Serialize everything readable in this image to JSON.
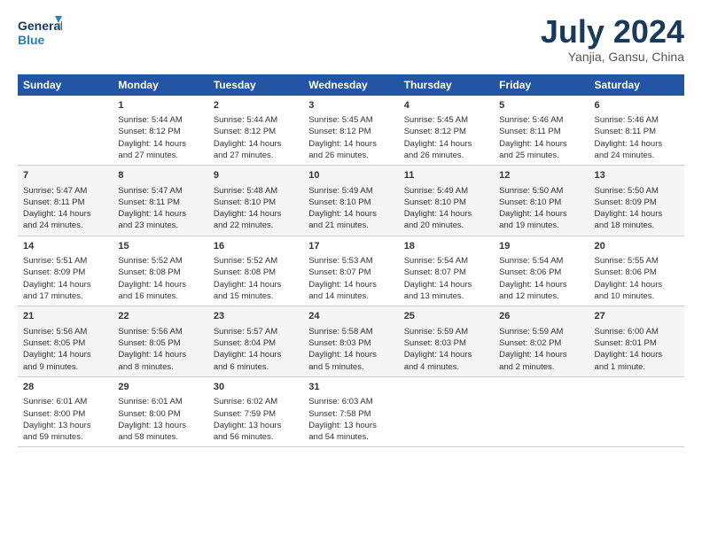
{
  "logo": {
    "text_general": "General",
    "text_blue": "Blue"
  },
  "title": "July 2024",
  "location": "Yanjia, Gansu, China",
  "header": {
    "days": [
      "Sunday",
      "Monday",
      "Tuesday",
      "Wednesday",
      "Thursday",
      "Friday",
      "Saturday"
    ]
  },
  "weeks": [
    [
      {
        "num": "",
        "info": ""
      },
      {
        "num": "1",
        "info": "Sunrise: 5:44 AM\nSunset: 8:12 PM\nDaylight: 14 hours\nand 27 minutes."
      },
      {
        "num": "2",
        "info": "Sunrise: 5:44 AM\nSunset: 8:12 PM\nDaylight: 14 hours\nand 27 minutes."
      },
      {
        "num": "3",
        "info": "Sunrise: 5:45 AM\nSunset: 8:12 PM\nDaylight: 14 hours\nand 26 minutes."
      },
      {
        "num": "4",
        "info": "Sunrise: 5:45 AM\nSunset: 8:12 PM\nDaylight: 14 hours\nand 26 minutes."
      },
      {
        "num": "5",
        "info": "Sunrise: 5:46 AM\nSunset: 8:11 PM\nDaylight: 14 hours\nand 25 minutes."
      },
      {
        "num": "6",
        "info": "Sunrise: 5:46 AM\nSunset: 8:11 PM\nDaylight: 14 hours\nand 24 minutes."
      }
    ],
    [
      {
        "num": "7",
        "info": "Sunrise: 5:47 AM\nSunset: 8:11 PM\nDaylight: 14 hours\nand 24 minutes."
      },
      {
        "num": "8",
        "info": "Sunrise: 5:47 AM\nSunset: 8:11 PM\nDaylight: 14 hours\nand 23 minutes."
      },
      {
        "num": "9",
        "info": "Sunrise: 5:48 AM\nSunset: 8:10 PM\nDaylight: 14 hours\nand 22 minutes."
      },
      {
        "num": "10",
        "info": "Sunrise: 5:49 AM\nSunset: 8:10 PM\nDaylight: 14 hours\nand 21 minutes."
      },
      {
        "num": "11",
        "info": "Sunrise: 5:49 AM\nSunset: 8:10 PM\nDaylight: 14 hours\nand 20 minutes."
      },
      {
        "num": "12",
        "info": "Sunrise: 5:50 AM\nSunset: 8:10 PM\nDaylight: 14 hours\nand 19 minutes."
      },
      {
        "num": "13",
        "info": "Sunrise: 5:50 AM\nSunset: 8:09 PM\nDaylight: 14 hours\nand 18 minutes."
      }
    ],
    [
      {
        "num": "14",
        "info": "Sunrise: 5:51 AM\nSunset: 8:09 PM\nDaylight: 14 hours\nand 17 minutes."
      },
      {
        "num": "15",
        "info": "Sunrise: 5:52 AM\nSunset: 8:08 PM\nDaylight: 14 hours\nand 16 minutes."
      },
      {
        "num": "16",
        "info": "Sunrise: 5:52 AM\nSunset: 8:08 PM\nDaylight: 14 hours\nand 15 minutes."
      },
      {
        "num": "17",
        "info": "Sunrise: 5:53 AM\nSunset: 8:07 PM\nDaylight: 14 hours\nand 14 minutes."
      },
      {
        "num": "18",
        "info": "Sunrise: 5:54 AM\nSunset: 8:07 PM\nDaylight: 14 hours\nand 13 minutes."
      },
      {
        "num": "19",
        "info": "Sunrise: 5:54 AM\nSunset: 8:06 PM\nDaylight: 14 hours\nand 12 minutes."
      },
      {
        "num": "20",
        "info": "Sunrise: 5:55 AM\nSunset: 8:06 PM\nDaylight: 14 hours\nand 10 minutes."
      }
    ],
    [
      {
        "num": "21",
        "info": "Sunrise: 5:56 AM\nSunset: 8:05 PM\nDaylight: 14 hours\nand 9 minutes."
      },
      {
        "num": "22",
        "info": "Sunrise: 5:56 AM\nSunset: 8:05 PM\nDaylight: 14 hours\nand 8 minutes."
      },
      {
        "num": "23",
        "info": "Sunrise: 5:57 AM\nSunset: 8:04 PM\nDaylight: 14 hours\nand 6 minutes."
      },
      {
        "num": "24",
        "info": "Sunrise: 5:58 AM\nSunset: 8:03 PM\nDaylight: 14 hours\nand 5 minutes."
      },
      {
        "num": "25",
        "info": "Sunrise: 5:59 AM\nSunset: 8:03 PM\nDaylight: 14 hours\nand 4 minutes."
      },
      {
        "num": "26",
        "info": "Sunrise: 5:59 AM\nSunset: 8:02 PM\nDaylight: 14 hours\nand 2 minutes."
      },
      {
        "num": "27",
        "info": "Sunrise: 6:00 AM\nSunset: 8:01 PM\nDaylight: 14 hours\nand 1 minute."
      }
    ],
    [
      {
        "num": "28",
        "info": "Sunrise: 6:01 AM\nSunset: 8:00 PM\nDaylight: 13 hours\nand 59 minutes."
      },
      {
        "num": "29",
        "info": "Sunrise: 6:01 AM\nSunset: 8:00 PM\nDaylight: 13 hours\nand 58 minutes."
      },
      {
        "num": "30",
        "info": "Sunrise: 6:02 AM\nSunset: 7:59 PM\nDaylight: 13 hours\nand 56 minutes."
      },
      {
        "num": "31",
        "info": "Sunrise: 6:03 AM\nSunset: 7:58 PM\nDaylight: 13 hours\nand 54 minutes."
      },
      {
        "num": "",
        "info": ""
      },
      {
        "num": "",
        "info": ""
      },
      {
        "num": "",
        "info": ""
      }
    ]
  ]
}
